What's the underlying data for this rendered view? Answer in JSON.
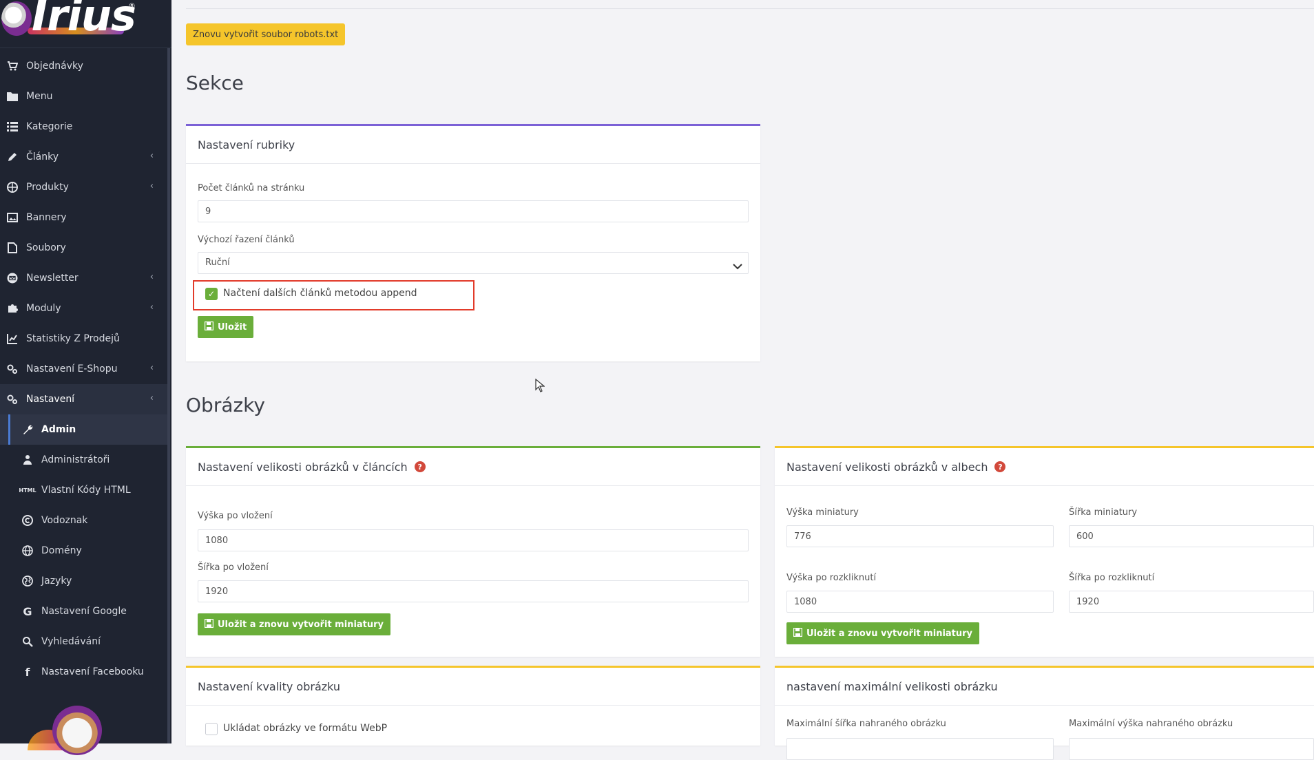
{
  "sidebar": {
    "logo": "Irius",
    "items": [
      {
        "label": "Objednávky",
        "icon": "cart-icon"
      },
      {
        "label": "Menu",
        "icon": "folder-icon"
      },
      {
        "label": "Kategorie",
        "icon": "list-icon"
      },
      {
        "label": "Články",
        "icon": "pencil-icon"
      },
      {
        "label": "Produkty",
        "icon": "basketball-icon"
      },
      {
        "label": "Bannery",
        "icon": "image-icon"
      },
      {
        "label": "Soubory",
        "icon": "file-icon"
      },
      {
        "label": "Newsletter",
        "icon": "envelope-icon"
      },
      {
        "label": "Moduly",
        "icon": "puzzle-icon"
      },
      {
        "label": "Statistiky Z Prodejů",
        "icon": "chart-icon"
      },
      {
        "label": "Nastavení E-Shopu",
        "icon": "cogs-icon"
      },
      {
        "label": "Nastavení",
        "icon": "cogs-icon"
      }
    ],
    "subitems": [
      {
        "label": "Admin",
        "icon": "wrench-icon"
      },
      {
        "label": "Administrátoři",
        "icon": "user-icon"
      },
      {
        "label": "Vlastní Kódy HTML",
        "icon": "html-icon"
      },
      {
        "label": "Vodoznak",
        "icon": "copyright-icon"
      },
      {
        "label": "Domény",
        "icon": "globe-icon"
      },
      {
        "label": "Jazyky",
        "icon": "globe-americas-icon"
      },
      {
        "label": "Nastavení Google",
        "icon": "google-icon"
      },
      {
        "label": "Vyhledávání",
        "icon": "search-icon"
      },
      {
        "label": "Nastavení Facebooku",
        "icon": "facebook-icon"
      }
    ]
  },
  "main": {
    "robots_button": "Znovu vytvořit soubor robots.txt",
    "section_sekce": "Sekce",
    "rubriky": {
      "title": "Nastavení rubriky",
      "per_page_label": "Počet článků na stránku",
      "per_page_value": "9",
      "order_label": "Výchozí řazení článků",
      "order_value": "Ruční",
      "append_label": "Načtení dalších článků metodou append",
      "save": "Uložit"
    },
    "section_obrazky": "Obrázky",
    "clanky_img": {
      "title": "Nastavení velikosti obrázků v článcích",
      "height_label": "Výška po vložení",
      "height_value": "1080",
      "width_label": "Šířka po vložení",
      "width_value": "1920",
      "save": "Uložit a znovu vytvořit miniatury"
    },
    "alba_img": {
      "title": "Nastavení velikosti obrázků v albech",
      "thumb_h_label": "Výška miniatury",
      "thumb_h_value": "776",
      "thumb_w_label": "Šířka miniatury",
      "thumb_w_value": "600",
      "full_h_label": "Výška po rozkliknutí",
      "full_h_value": "1080",
      "full_w_label": "Šířka po rozkliknutí",
      "full_w_value": "1920",
      "save": "Uložit a znovu vytvořit miniatury"
    },
    "kvalita": {
      "title": "Nastavení kvality obrázku",
      "webp_label": "Ukládat obrázky ve formátu WebP"
    },
    "max_size": {
      "title": "nastavení maximální velikosti obrázku",
      "max_w_label": "Maximální šířka nahraného obrázku",
      "max_h_label": "Maximální výška nahraného obrázku"
    }
  },
  "colors": {
    "sidebar_bg": "#1f2431",
    "accent_purple": "#7b61d6",
    "accent_green": "#6aae3a",
    "accent_yellow": "#f5c52b",
    "highlight_red": "#e23b2a"
  }
}
